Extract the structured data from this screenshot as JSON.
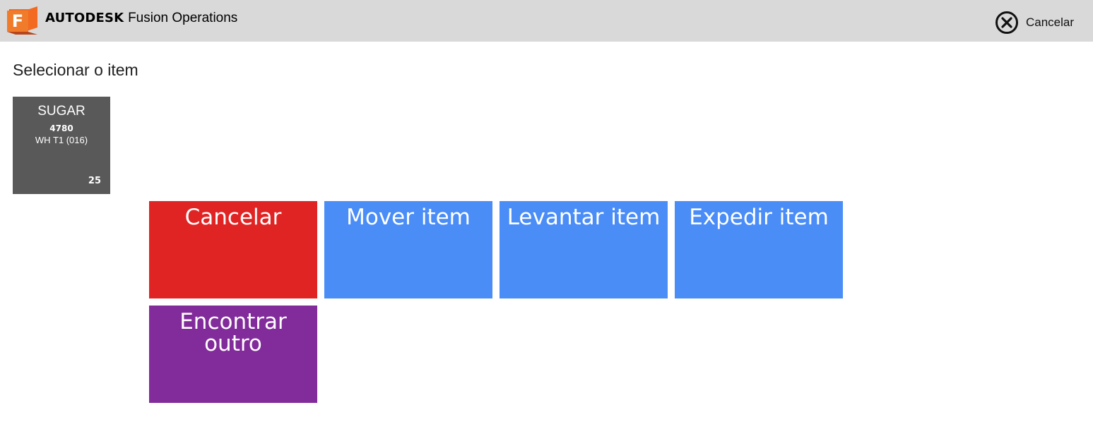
{
  "header": {
    "logo_letter": "F",
    "brand": "AUTODESK",
    "product": "Fusion Operations",
    "cancel_label": "Cancelar",
    "colors": {
      "background": "#d9d9d9",
      "logo_orange": "#f26b21",
      "logo_dark_orange": "#c9501a"
    },
    "icons": {
      "logo": "fusion-logo-icon",
      "cancel": "close-circle-icon"
    }
  },
  "page": {
    "title": "Selecionar o item"
  },
  "item": {
    "name": "SUGAR",
    "code": "4780",
    "location": "WH T1 (016)",
    "quantity": "25",
    "color": "#595959"
  },
  "actions": [
    {
      "label": "Cancelar",
      "color": "#e02424"
    },
    {
      "label": "Mover item",
      "color": "#4a8df7"
    },
    {
      "label": "Levantar item",
      "color": "#4a8df7"
    },
    {
      "label": "Expedir item",
      "color": "#4a8df7"
    },
    {
      "label": "Encontrar outro",
      "color": "#822b9b"
    }
  ]
}
